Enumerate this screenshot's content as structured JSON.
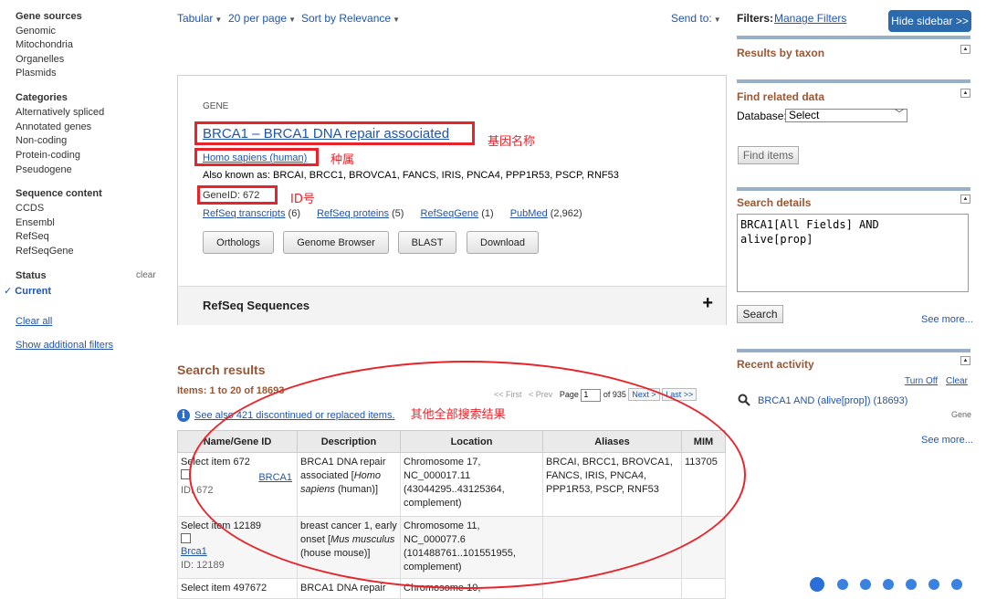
{
  "left_sidebar": {
    "gene_sources": {
      "heading": "Gene sources",
      "items": [
        "Genomic",
        "Mitochondria",
        "Organelles",
        "Plasmids"
      ]
    },
    "categories": {
      "heading": "Categories",
      "items": [
        "Alternatively spliced",
        "Annotated genes",
        "Non-coding",
        "Protein-coding",
        "Pseudogene"
      ]
    },
    "sequence_content": {
      "heading": "Sequence content",
      "items": [
        "CCDS",
        "Ensembl",
        "RefSeq",
        "RefSeqGene"
      ]
    },
    "status": {
      "heading": "Status",
      "clear": "clear",
      "current": "Current"
    },
    "clear_all": "Clear all",
    "show_filters": "Show additional filters"
  },
  "toolbar": {
    "format": "Tabular",
    "per_page": "20 per page",
    "sort": "Sort by Relevance",
    "send_to": "Send to:"
  },
  "gene": {
    "label": "GENE",
    "title": "BRCA1 – BRCA1 DNA repair associated",
    "organism": "Homo sapiens (human)",
    "aka": "Also known as: BRCAI, BRCC1, BROVCA1, FANCS, IRIS, PNCA4, PPP1R53, PSCP, RNF53",
    "gene_id": "GeneID: 672",
    "links": [
      {
        "label": "RefSeq transcripts",
        "count": "(6)"
      },
      {
        "label": "RefSeq proteins",
        "count": "(5)"
      },
      {
        "label": "RefSeqGene",
        "count": "(1)"
      },
      {
        "label": "PubMed",
        "count": "(2,962)"
      }
    ],
    "buttons": [
      "Orthologs",
      "Genome Browser",
      "BLAST",
      "Download"
    ],
    "refseq_section": "RefSeq Sequences",
    "expand_symbol": "+"
  },
  "annotations": {
    "gene_name": "基因名称",
    "genus": "种属",
    "id_number": "ID号",
    "other_results": "其他全部搜索结果"
  },
  "search_results": {
    "title": "Search results",
    "items": "Items: 1 to 20 of 18693",
    "pager": {
      "first": "<< First",
      "prev": "< Prev",
      "page_label": "Page",
      "page_value": "1",
      "of_total": "of 935",
      "next": "Next >",
      "last": "Last >>"
    },
    "info_icon": "i",
    "discontinued": "See also 421 discontinued or replaced items.",
    "columns": [
      "Name/Gene ID",
      "Description",
      "Location",
      "Aliases",
      "MIM"
    ],
    "rows": [
      {
        "select": "Select item 672",
        "name": "BRCA1",
        "id": "ID: 672",
        "desc_text": "BRCA1 DNA repair associated [",
        "desc_org": "Homo sapiens",
        "desc_tail": " (human)]",
        "location": "Chromosome 17, NC_000017.11 (43044295..43125364, complement)",
        "aliases": "BRCAI, BRCC1, BROVCA1, FANCS, IRIS, PNCA4, PPP1R53, PSCP, RNF53",
        "mim": "113705"
      },
      {
        "select": "Select item 12189",
        "name": "Brca1",
        "id": "ID: 12189",
        "desc_text": "breast cancer 1, early onset [",
        "desc_org": "Mus musculus",
        "desc_tail": " (house mouse)]",
        "location": "Chromosome 11, NC_000077.6 (101488761..101551955, complement)",
        "aliases": "",
        "mim": ""
      },
      {
        "select": "Select item 497672",
        "name": "",
        "id": "",
        "desc_text": "BRCA1 DNA repair",
        "desc_org": "",
        "desc_tail": "",
        "location": "Chromosome 10,",
        "aliases": "",
        "mim": ""
      }
    ]
  },
  "right_sidebar": {
    "filters_label": "Filters:",
    "manage_filters": "Manage Filters",
    "hide_sidebar": "Hide sidebar >>",
    "results_by_taxon": "Results by taxon",
    "find_related": "Find related data",
    "database_label": "Database:",
    "database_value": "Select",
    "find_items": "Find items",
    "search_details": "Search details",
    "query": "BRCA1[All Fields] AND\nalive[prop]",
    "search_button": "Search",
    "see_more_1": "See more...",
    "recent_activity": "Recent activity",
    "turn_off": "Turn Off",
    "clear": "Clear",
    "recent_query": "BRCA1 AND (alive[prop]) (18693)",
    "recent_db": "Gene",
    "see_more_2": "See more..."
  }
}
